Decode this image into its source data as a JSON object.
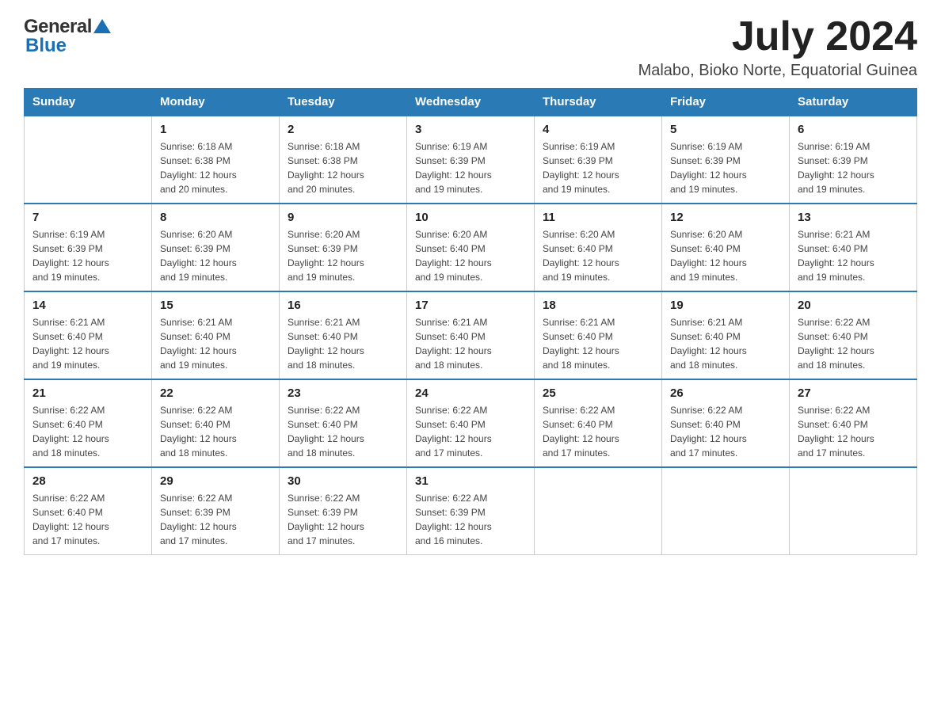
{
  "header": {
    "logo_general": "General",
    "logo_blue": "Blue",
    "month_year": "July 2024",
    "location": "Malabo, Bioko Norte, Equatorial Guinea"
  },
  "weekdays": [
    "Sunday",
    "Monday",
    "Tuesday",
    "Wednesday",
    "Thursday",
    "Friday",
    "Saturday"
  ],
  "weeks": [
    [
      {
        "day": "",
        "info": ""
      },
      {
        "day": "1",
        "info": "Sunrise: 6:18 AM\nSunset: 6:38 PM\nDaylight: 12 hours\nand 20 minutes."
      },
      {
        "day": "2",
        "info": "Sunrise: 6:18 AM\nSunset: 6:38 PM\nDaylight: 12 hours\nand 20 minutes."
      },
      {
        "day": "3",
        "info": "Sunrise: 6:19 AM\nSunset: 6:39 PM\nDaylight: 12 hours\nand 19 minutes."
      },
      {
        "day": "4",
        "info": "Sunrise: 6:19 AM\nSunset: 6:39 PM\nDaylight: 12 hours\nand 19 minutes."
      },
      {
        "day": "5",
        "info": "Sunrise: 6:19 AM\nSunset: 6:39 PM\nDaylight: 12 hours\nand 19 minutes."
      },
      {
        "day": "6",
        "info": "Sunrise: 6:19 AM\nSunset: 6:39 PM\nDaylight: 12 hours\nand 19 minutes."
      }
    ],
    [
      {
        "day": "7",
        "info": "Sunrise: 6:19 AM\nSunset: 6:39 PM\nDaylight: 12 hours\nand 19 minutes."
      },
      {
        "day": "8",
        "info": "Sunrise: 6:20 AM\nSunset: 6:39 PM\nDaylight: 12 hours\nand 19 minutes."
      },
      {
        "day": "9",
        "info": "Sunrise: 6:20 AM\nSunset: 6:39 PM\nDaylight: 12 hours\nand 19 minutes."
      },
      {
        "day": "10",
        "info": "Sunrise: 6:20 AM\nSunset: 6:40 PM\nDaylight: 12 hours\nand 19 minutes."
      },
      {
        "day": "11",
        "info": "Sunrise: 6:20 AM\nSunset: 6:40 PM\nDaylight: 12 hours\nand 19 minutes."
      },
      {
        "day": "12",
        "info": "Sunrise: 6:20 AM\nSunset: 6:40 PM\nDaylight: 12 hours\nand 19 minutes."
      },
      {
        "day": "13",
        "info": "Sunrise: 6:21 AM\nSunset: 6:40 PM\nDaylight: 12 hours\nand 19 minutes."
      }
    ],
    [
      {
        "day": "14",
        "info": "Sunrise: 6:21 AM\nSunset: 6:40 PM\nDaylight: 12 hours\nand 19 minutes."
      },
      {
        "day": "15",
        "info": "Sunrise: 6:21 AM\nSunset: 6:40 PM\nDaylight: 12 hours\nand 19 minutes."
      },
      {
        "day": "16",
        "info": "Sunrise: 6:21 AM\nSunset: 6:40 PM\nDaylight: 12 hours\nand 18 minutes."
      },
      {
        "day": "17",
        "info": "Sunrise: 6:21 AM\nSunset: 6:40 PM\nDaylight: 12 hours\nand 18 minutes."
      },
      {
        "day": "18",
        "info": "Sunrise: 6:21 AM\nSunset: 6:40 PM\nDaylight: 12 hours\nand 18 minutes."
      },
      {
        "day": "19",
        "info": "Sunrise: 6:21 AM\nSunset: 6:40 PM\nDaylight: 12 hours\nand 18 minutes."
      },
      {
        "day": "20",
        "info": "Sunrise: 6:22 AM\nSunset: 6:40 PM\nDaylight: 12 hours\nand 18 minutes."
      }
    ],
    [
      {
        "day": "21",
        "info": "Sunrise: 6:22 AM\nSunset: 6:40 PM\nDaylight: 12 hours\nand 18 minutes."
      },
      {
        "day": "22",
        "info": "Sunrise: 6:22 AM\nSunset: 6:40 PM\nDaylight: 12 hours\nand 18 minutes."
      },
      {
        "day": "23",
        "info": "Sunrise: 6:22 AM\nSunset: 6:40 PM\nDaylight: 12 hours\nand 18 minutes."
      },
      {
        "day": "24",
        "info": "Sunrise: 6:22 AM\nSunset: 6:40 PM\nDaylight: 12 hours\nand 17 minutes."
      },
      {
        "day": "25",
        "info": "Sunrise: 6:22 AM\nSunset: 6:40 PM\nDaylight: 12 hours\nand 17 minutes."
      },
      {
        "day": "26",
        "info": "Sunrise: 6:22 AM\nSunset: 6:40 PM\nDaylight: 12 hours\nand 17 minutes."
      },
      {
        "day": "27",
        "info": "Sunrise: 6:22 AM\nSunset: 6:40 PM\nDaylight: 12 hours\nand 17 minutes."
      }
    ],
    [
      {
        "day": "28",
        "info": "Sunrise: 6:22 AM\nSunset: 6:40 PM\nDaylight: 12 hours\nand 17 minutes."
      },
      {
        "day": "29",
        "info": "Sunrise: 6:22 AM\nSunset: 6:39 PM\nDaylight: 12 hours\nand 17 minutes."
      },
      {
        "day": "30",
        "info": "Sunrise: 6:22 AM\nSunset: 6:39 PM\nDaylight: 12 hours\nand 17 minutes."
      },
      {
        "day": "31",
        "info": "Sunrise: 6:22 AM\nSunset: 6:39 PM\nDaylight: 12 hours\nand 16 minutes."
      },
      {
        "day": "",
        "info": ""
      },
      {
        "day": "",
        "info": ""
      },
      {
        "day": "",
        "info": ""
      }
    ]
  ]
}
